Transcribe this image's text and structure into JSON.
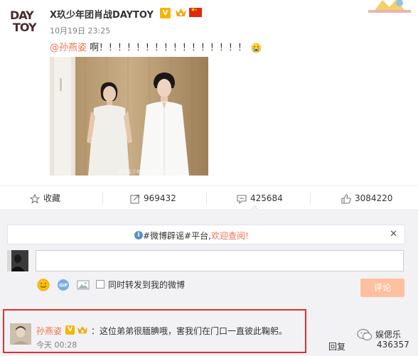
{
  "post": {
    "author": "X玖少年团肖战DAYTOY",
    "avatar_text_1": "DAY",
    "avatar_text_2": "TOY",
    "verified_label": "V",
    "time": "10月19日 23:25",
    "mention": "@孙燕姿",
    "text": " 啊！！！！！！！！！！！！！！！！",
    "image_watermark": "@X玖少年团肖战DAYTOY"
  },
  "actions": {
    "favorite_label": "收藏",
    "repost_count": "969432",
    "comment_count": "425684",
    "like_count": "3084220"
  },
  "comments": {
    "notice_prefix": "#微博辟谣#平台,",
    "notice_link": "欢迎查阅!",
    "input_placeholder": "",
    "repost_label": "同时转发到我的微博",
    "submit_label": "评论",
    "items": [
      {
        "author": "孙燕姿",
        "verified_label": "V",
        "text": "：这位弟弟很腼腆哦，害我们在门口一直彼此鞠躬。",
        "time": "今天 00:28",
        "reply_label": "回复",
        "like_count": "436357"
      }
    ]
  },
  "watermark": "娱偲乐",
  "colors": {
    "accent": "#eb7350",
    "highlight_border": "#e02f2f",
    "submit_bg": "#ffc09f",
    "verified": "#f7b500"
  }
}
